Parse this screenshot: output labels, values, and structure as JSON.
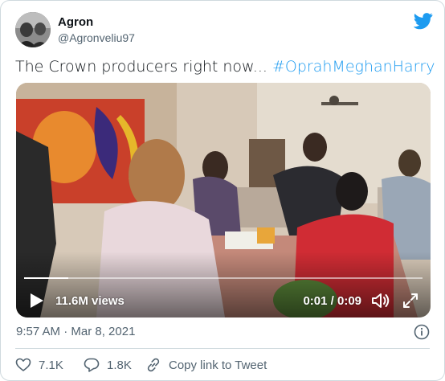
{
  "user": {
    "name": "Agron",
    "handle": "@Agronveliu97"
  },
  "tweet": {
    "text": "The Crown producers right now... ",
    "hashtag": "#OprahMeghanHarry"
  },
  "video": {
    "views": "11.6M views",
    "time": "0:01 / 0:09",
    "progress_fraction": 0.11
  },
  "timestamp": "9:57 AM · Mar 8, 2021",
  "actions": {
    "likes": "7.1K",
    "replies": "1.8K",
    "copy_link": "Copy link to Tweet"
  },
  "colors": {
    "accent": "#1d9bf0",
    "secondary_text": "#536471",
    "border": "#cfd9de"
  },
  "icons": [
    "twitter-bird-icon",
    "play-icon",
    "volume-icon",
    "fullscreen-icon",
    "info-icon",
    "heart-icon",
    "reply-icon",
    "link-icon"
  ]
}
